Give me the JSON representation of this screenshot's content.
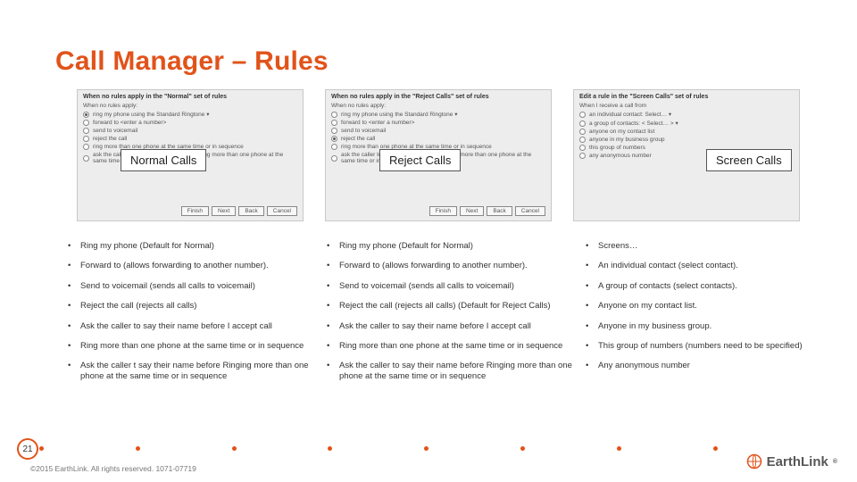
{
  "title": "Call Manager – Rules",
  "panels": {
    "normal": {
      "header": "When no rules apply in the \"Normal\" set of rules",
      "sub": "When no rules apply:",
      "options": [
        "ring my phone using the Standard Ringtone ▾",
        "forward to  <enter a number>",
        "send to voicemail",
        "reject the call",
        "ring more than one phone at the same time or in sequence",
        "ask the caller to say their name before ringing more than one phone at the same time or in sequence"
      ],
      "label": "Normal Calls"
    },
    "reject": {
      "header": "When no rules apply in the \"Reject Calls\" set of rules",
      "sub": "When no rules apply:",
      "options": [
        "ring my phone using the Standard Ringtone ▾",
        "forward to  <enter a number>",
        "send to voicemail",
        "reject the call",
        "ring more than one phone at the same time or in sequence",
        "ask the caller to say their name before ringing more than one phone at the same time or in sequence"
      ],
      "label": "Reject Calls"
    },
    "screen": {
      "header": "Edit a rule in the \"Screen Calls\" set of rules",
      "sub": "When I receive a call from",
      "options": [
        "an individual contact:  Select… ▾",
        "a group of contacts:  < Select… > ▾",
        "anyone on my contact list",
        "anyone in my business group",
        "this group of numbers",
        "any anonymous number"
      ],
      "label": "Screen Calls"
    },
    "buttons": [
      "Finish",
      "Next",
      "Back",
      "Cancel"
    ]
  },
  "columns": {
    "normal": [
      "Ring my phone (Default for Normal)",
      "Forward to (allows forwarding to another number).",
      "Send to voicemail (sends all calls to voicemail)",
      "Reject the call (rejects all calls)",
      "Ask the caller to say their name before I accept call",
      "Ring more than one phone at the same time or in sequence",
      "Ask the caller t say their name before Ringing more than one phone at the same time or in sequence"
    ],
    "reject": [
      "Ring my phone (Default for Normal)",
      "Forward to (allows forwarding to another number).",
      "Send to voicemail (sends all calls to voicemail)",
      "Reject the call (rejects all calls) (Default for Reject Calls)",
      "Ask the caller to say their name before I accept call",
      "Ring more than one phone at the same time or in sequence",
      "Ask the caller to say their name before Ringing more than one phone at the same time or in sequence"
    ],
    "screen": [
      "Screens…",
      "An individual contact (select contact).",
      "A group of contacts (select contacts).",
      "Anyone on my contact list.",
      "Anyone in my business group.",
      "This group of numbers (numbers need to be specified)",
      "Any anonymous number"
    ]
  },
  "footer": {
    "page": "21",
    "copyright": "©2015 EarthLink. All rights reserved. 1071-07719",
    "logo_text": "EarthLink"
  }
}
